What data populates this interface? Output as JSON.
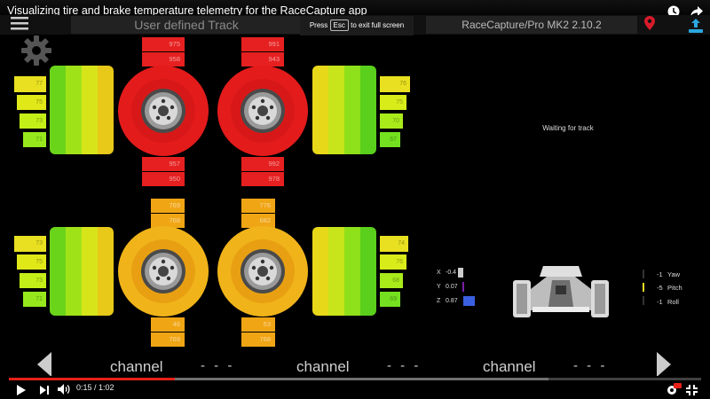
{
  "video": {
    "title": "Visualizing tire and brake temperature telemetry for the RaceCapture app",
    "current_time": "0:15",
    "duration": "1:02",
    "time_display": "0:15 / 1:02",
    "progress": 0.24
  },
  "fullscreen_hint": {
    "press": "Press",
    "key": "Esc",
    "rest": "to exit full screen"
  },
  "app": {
    "track_name": "User defined Track",
    "device_name": "RaceCapture/Pro MK2 2.10.2",
    "status": "Waiting for track"
  },
  "brakes": {
    "front_left": {
      "top": [
        "975",
        "958"
      ],
      "bottom": [
        "957",
        "950"
      ],
      "color": "#e62020"
    },
    "front_right": {
      "top": [
        "991",
        "943"
      ],
      "bottom": [
        "992",
        "978"
      ],
      "color": "#e62020"
    },
    "rear_left": {
      "top": [
        "769",
        "768"
      ],
      "bottom": [
        "46",
        "769"
      ],
      "color": "#f0a515"
    },
    "rear_right": {
      "top": [
        "776",
        "682"
      ],
      "bottom": [
        "53",
        "768"
      ],
      "color": "#f0a515"
    }
  },
  "tires": {
    "front_left": {
      "values": [
        "77",
        "75",
        "73",
        "71"
      ]
    },
    "front_right": {
      "values": [
        "76",
        "75",
        "70",
        "67"
      ]
    },
    "rear_left": {
      "values": [
        "73",
        "75",
        "73",
        "71"
      ]
    },
    "rear_right": {
      "values": [
        "74",
        "76",
        "68",
        "69"
      ]
    }
  },
  "imu": {
    "x": {
      "label": "X",
      "value": "-0.4",
      "color": "#cccccc"
    },
    "y": {
      "label": "Y",
      "value": "0.07",
      "color": "#7a1fa8"
    },
    "z": {
      "label": "Z",
      "value": "0.87",
      "color": "#3a5fe0"
    },
    "yaw": {
      "value": "-1",
      "label": "Yaw"
    },
    "pitch": {
      "value": "-5",
      "label": "Pitch",
      "color": "#e8e020"
    },
    "roll": {
      "value": "-1",
      "label": "Roll"
    }
  },
  "channels": [
    {
      "label": "channel",
      "value": "- - -"
    },
    {
      "label": "channel",
      "value": "- - -"
    },
    {
      "label": "channel",
      "value": "- - -"
    }
  ],
  "icons": {
    "clock": "clock-icon",
    "share": "share-icon",
    "menu": "hamburger-menu-icon",
    "gps": "location-pin-icon",
    "upload": "upload-icon",
    "settings": "gear-icon",
    "play": "play-icon",
    "next": "next-icon",
    "volume": "volume-icon",
    "hd": "settings-hd-icon",
    "exit_fullscreen": "exit-fullscreen-icon"
  }
}
